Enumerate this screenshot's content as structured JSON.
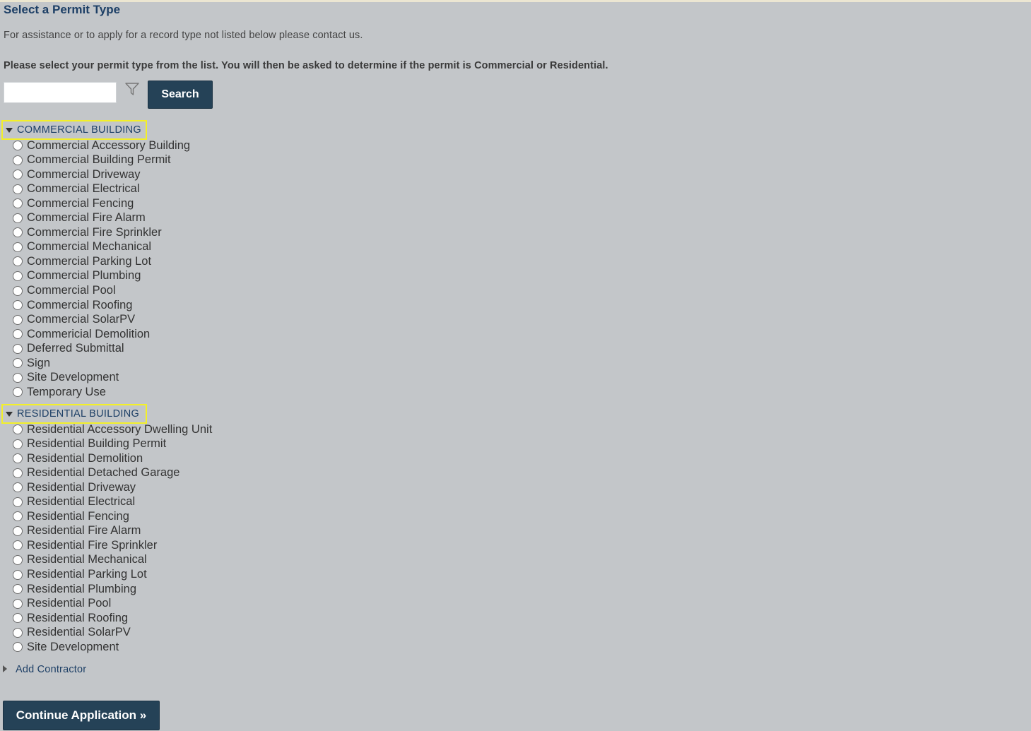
{
  "page": {
    "title": "Select a Permit Type",
    "assistance_text": "For assistance or to apply for a record type not listed below please contact us.",
    "instruction_text": "Please select your permit type from the list. You will then be asked to determine if the permit is Commercial or Residential."
  },
  "search": {
    "placeholder": "",
    "value": "",
    "button_label": "Search",
    "filter_icon": "filter-funnel-icon"
  },
  "categories": [
    {
      "label": "COMMERCIAL BUILDING",
      "expanded": true,
      "items": [
        "Commercial Accessory Building",
        "Commercial Building Permit",
        "Commercial Driveway",
        "Commercial Electrical",
        "Commercial Fencing",
        "Commercial Fire Alarm",
        "Commercial Fire Sprinkler",
        "Commercial Mechanical",
        "Commercial Parking Lot",
        "Commercial Plumbing",
        "Commercial Pool",
        "Commercial Roofing",
        "Commercial SolarPV",
        "Commericial Demolition",
        "Deferred Submittal",
        "Sign",
        "Site Development",
        "Temporary Use"
      ]
    },
    {
      "label": "RESIDENTIAL BUILDING",
      "expanded": true,
      "items": [
        "Residential Accessory Dwelling Unit",
        "Residential Building Permit",
        "Residential Demolition",
        "Residential Detached Garage",
        "Residential Driveway",
        "Residential Electrical",
        "Residential Fencing",
        "Residential Fire Alarm",
        "Residential Fire Sprinkler",
        "Residential Mechanical",
        "Residential Parking Lot",
        "Residential Plumbing",
        "Residential Pool",
        "Residential Roofing",
        "Residential SolarPV",
        "Site Development"
      ]
    }
  ],
  "contractor": {
    "label": "Add Contractor"
  },
  "footer": {
    "continue_label": "Continue Application »"
  },
  "colors": {
    "background": "#c3c6c9",
    "heading": "#1d3f66",
    "button": "#254257",
    "highlight_border": "#f3f028"
  }
}
